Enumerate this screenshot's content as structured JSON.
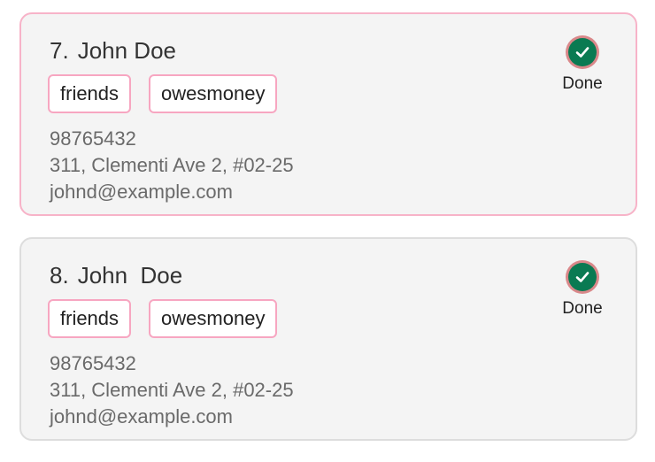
{
  "persons": [
    {
      "index": "7.",
      "name": "John Doe",
      "tags": [
        "friends",
        "owesmoney"
      ],
      "phone": "98765432",
      "address": "311, Clementi Ave 2, #02-25",
      "email": "johnd@example.com",
      "status": "Done",
      "status_icon": "check-circle-icon",
      "selected": true
    },
    {
      "index": "8.",
      "name": "John  Doe",
      "tags": [
        "friends",
        "owesmoney"
      ],
      "phone": "98765432",
      "address": "311, Clementi Ave 2, #02-25",
      "email": "johnd@example.com",
      "status": "Done",
      "status_icon": "check-circle-icon",
      "selected": false
    }
  ],
  "colors": {
    "selected_border": "#f7b3c8",
    "tag_border": "#f7a6c1",
    "done_green": "#0a7a52",
    "done_ring": "#d9888a"
  }
}
